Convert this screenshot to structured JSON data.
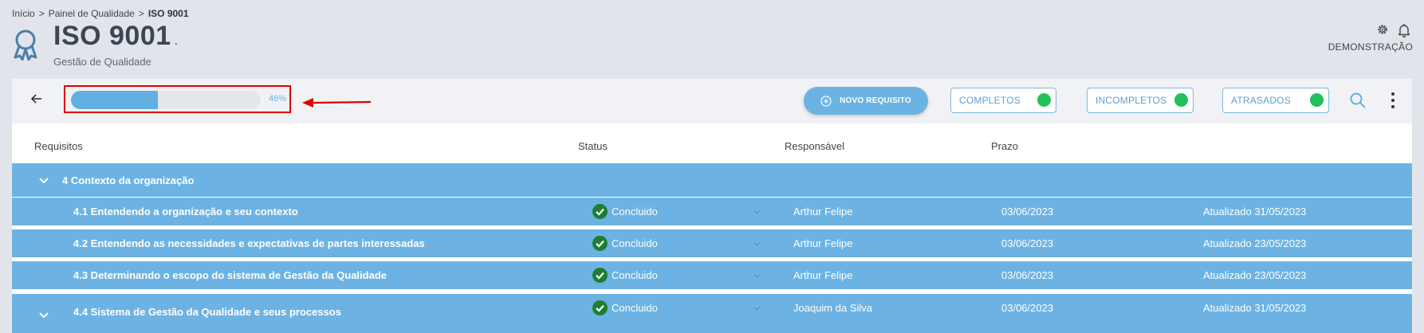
{
  "breadcrumb": {
    "home": "Início",
    "parent": "Painel de Qualidade",
    "current": "ISO 9001",
    "separator": ">"
  },
  "header": {
    "title": "ISO 9001",
    "title_suffix": ".",
    "subtitle": "Gestão de Qualidade",
    "user": "DEMONSTRAÇÃO"
  },
  "progress": {
    "value": 0.46,
    "label": "46%"
  },
  "toolbar": {
    "new_button": "NOVO REQUISITO",
    "toggles": [
      {
        "label": "COMPLETOS",
        "on": true
      },
      {
        "label": "INCOMPLETOS",
        "on": true
      },
      {
        "label": "ATRASADOS",
        "on": true
      }
    ]
  },
  "table": {
    "columns": {
      "requisitos": "Requisitos",
      "status": "Status",
      "responsavel": "Responsável",
      "prazo": "Prazo"
    },
    "group": {
      "title": "4 Contexto da organização"
    },
    "rows": [
      {
        "title": "4.1 Entendendo a organização e seu contexto",
        "status": "Concluido",
        "responsible": "Arthur Felipe",
        "deadline": "03/06/2023",
        "updated": "Atualizado 31/05/2023"
      },
      {
        "title": "4.2 Entendendo as necessidades e expectativas de partes interessadas",
        "status": "Concluido",
        "responsible": "Arthur Felipe",
        "deadline": "03/06/2023",
        "updated": "Atualizado 23/05/2023"
      },
      {
        "title": "4.3 Determinando o escopo do sistema de Gestão da Qualidade",
        "status": "Concluido",
        "responsible": "Arthur Felipe",
        "deadline": "03/06/2023",
        "updated": "Atualizado 23/05/2023"
      },
      {
        "title": "4.4 Sistema de Gestão da Qualidade e seus processos",
        "status": "Concluido",
        "responsible": "Joaquim da Silva",
        "deadline": "03/06/2023",
        "updated": "Atualizado 31/05/2023"
      }
    ]
  },
  "colors": {
    "accent": "#6cb3e3",
    "toggle_on": "#22c25a",
    "status_ok": "#1e7d32",
    "highlight": "#e20000"
  }
}
